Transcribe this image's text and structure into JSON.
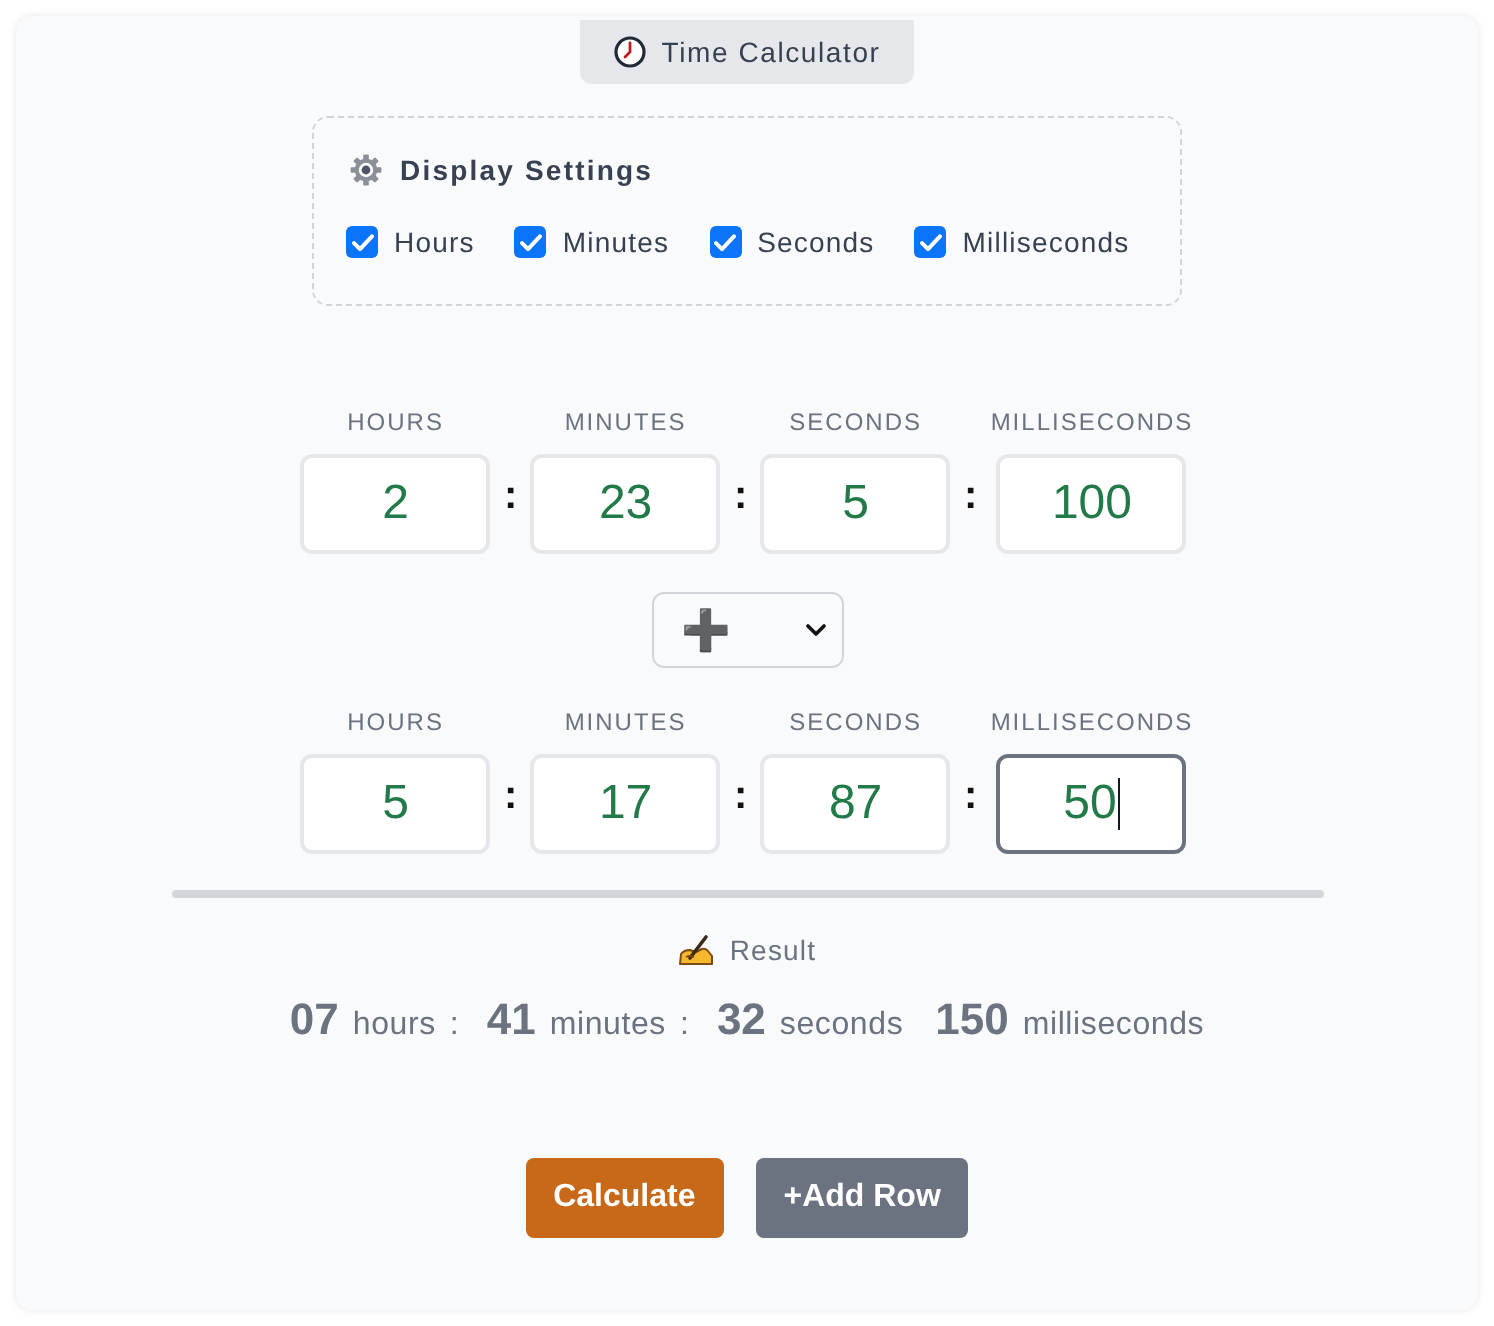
{
  "header": {
    "title": "Time Calculator"
  },
  "display_settings": {
    "title": "Display Settings",
    "options": [
      {
        "label": "Hours",
        "checked": true
      },
      {
        "label": "Minutes",
        "checked": true
      },
      {
        "label": "Seconds",
        "checked": true
      },
      {
        "label": "Milliseconds",
        "checked": true
      }
    ]
  },
  "rows": [
    {
      "fields": [
        {
          "label": "HOURS",
          "value": "2",
          "focused": false
        },
        {
          "label": "MINUTES",
          "value": "23",
          "focused": false
        },
        {
          "label": "SECONDS",
          "value": "5",
          "focused": false
        },
        {
          "label": "MILLISECONDS",
          "value": "100",
          "focused": false
        }
      ],
      "separators": [
        ":",
        ":",
        ":"
      ]
    },
    {
      "fields": [
        {
          "label": "HOURS",
          "value": "5",
          "focused": false
        },
        {
          "label": "MINUTES",
          "value": "17",
          "focused": false
        },
        {
          "label": "SECONDS",
          "value": "87",
          "focused": false
        },
        {
          "label": "MILLISECONDS",
          "value": "50",
          "focused": true
        }
      ],
      "separators": [
        ":",
        ":",
        ":"
      ]
    }
  ],
  "operator": {
    "value": "➕"
  },
  "result": {
    "label": "Result",
    "parts": [
      {
        "value": "07",
        "unit": "hours",
        "separator": ":"
      },
      {
        "value": "41",
        "unit": "minutes",
        "separator": ":"
      },
      {
        "value": "32",
        "unit": "seconds"
      },
      {
        "value": "150",
        "unit": "milliseconds"
      }
    ]
  },
  "buttons": [
    {
      "label": "Calculate",
      "kind": "primary"
    },
    {
      "label": "+Add Row",
      "kind": "secondary"
    }
  ]
}
